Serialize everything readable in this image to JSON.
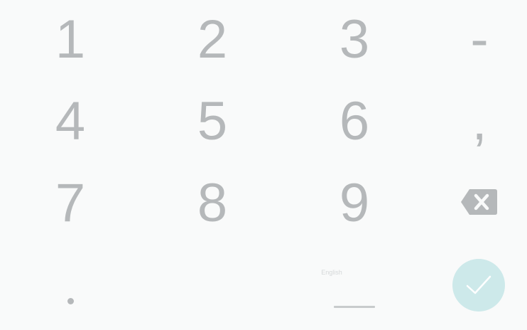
{
  "keypad": {
    "keys": {
      "one": "1",
      "two": "2",
      "three": "3",
      "dash": "-",
      "four": "4",
      "five": "5",
      "six": "6",
      "comma": ",",
      "seven": "7",
      "eight": "8",
      "nine": "9"
    },
    "language_label": "English"
  },
  "colors": {
    "background": "#f9fafa",
    "key_text": "#b5b8ba",
    "done_button": "#cde9ea",
    "done_check": "#ffffff"
  },
  "icons": {
    "backspace": "backspace-icon",
    "done": "checkmark-icon",
    "period": "period-dot-icon"
  }
}
